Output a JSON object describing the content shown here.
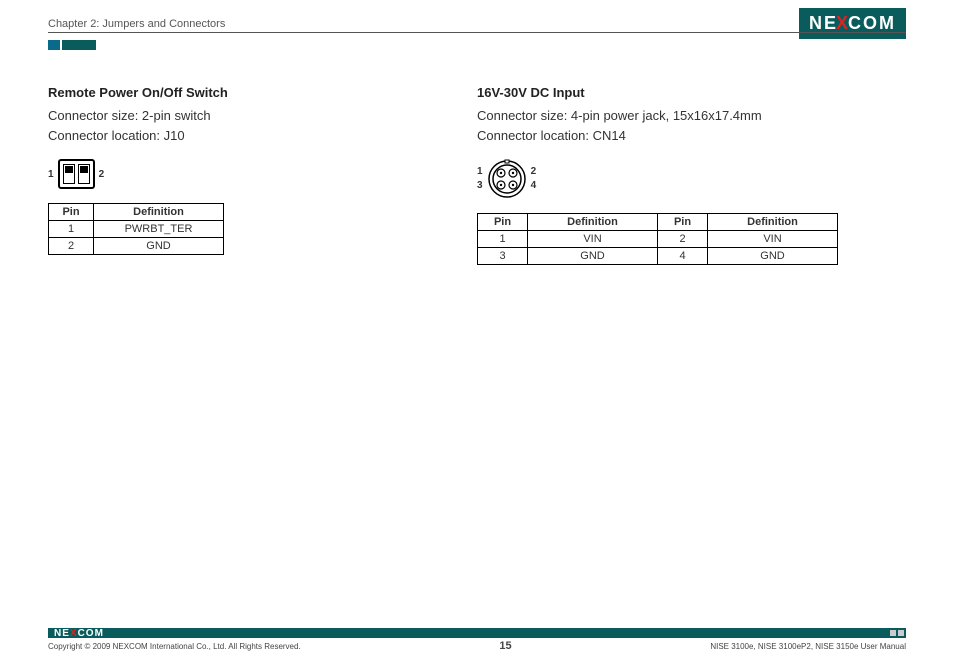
{
  "header": {
    "chapter": "Chapter 2: Jumpers and Connectors",
    "brand_pre": "NE",
    "brand_x": "X",
    "brand_post": "COM"
  },
  "left": {
    "heading": "Remote Power On/Off Switch",
    "line1": "Connector size: 2-pin switch",
    "line2": "Connector location: J10",
    "pin_left": "1",
    "pin_right": "2",
    "th_pin": "Pin",
    "th_def": "Definition",
    "rows": [
      {
        "pin": "1",
        "def": "PWRBT_TER"
      },
      {
        "pin": "2",
        "def": "GND"
      }
    ]
  },
  "right": {
    "heading": "16V-30V DC Input",
    "line1": "Connector size: 4-pin power jack, 15x16x17.4mm",
    "line2": "Connector location: CN14",
    "lab_1": "1",
    "lab_2": "2",
    "lab_3": "3",
    "lab_4": "4",
    "th_pin": "Pin",
    "th_def": "Definition",
    "rows": [
      {
        "p1": "1",
        "d1": "VIN",
        "p2": "2",
        "d2": "VIN"
      },
      {
        "p1": "3",
        "d1": "GND",
        "p2": "4",
        "d2": "GND"
      }
    ]
  },
  "footer": {
    "copyright": "Copyright © 2009 NEXCOM International Co., Ltd. All Rights Reserved.",
    "page": "15",
    "manual": "NISE 3100e, NISE 3100eP2, NISE 3150e User Manual",
    "brand_pre": "NE",
    "brand_x": "X",
    "brand_post": "COM"
  }
}
